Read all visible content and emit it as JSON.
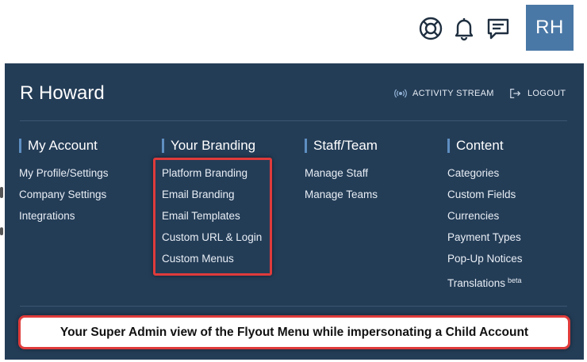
{
  "topbar": {
    "icons": [
      "lifebuoy-icon",
      "bell-icon",
      "chat-icon"
    ],
    "avatar_initials": "RH",
    "avatar_color": "#4a78a6"
  },
  "panel": {
    "bg_color": "#243d57",
    "user_name": "R Howard",
    "activity_stream_label": "ACTIVITY STREAM",
    "logout_label": "LOGOUT",
    "columns": [
      {
        "title": "My Account",
        "items": [
          "My Profile/Settings",
          "Company Settings",
          "Integrations"
        ]
      },
      {
        "title": "Your Branding",
        "items": [
          "Platform Branding",
          "Email Branding",
          "Email Templates",
          "Custom URL & Login",
          "Custom Menus"
        ]
      },
      {
        "title": "Staff/Team",
        "items": [
          "Manage Staff",
          "Manage Teams"
        ]
      },
      {
        "title": "Content",
        "items": [
          "Categories",
          "Custom Fields",
          "Currencies",
          "Payment Types",
          "Pop-Up Notices",
          "Translations"
        ],
        "badge": "beta"
      }
    ],
    "highlight_color": "#e03b3b",
    "note": "Your Super Admin view of the Flyout Menu while impersonating a Child Account"
  }
}
